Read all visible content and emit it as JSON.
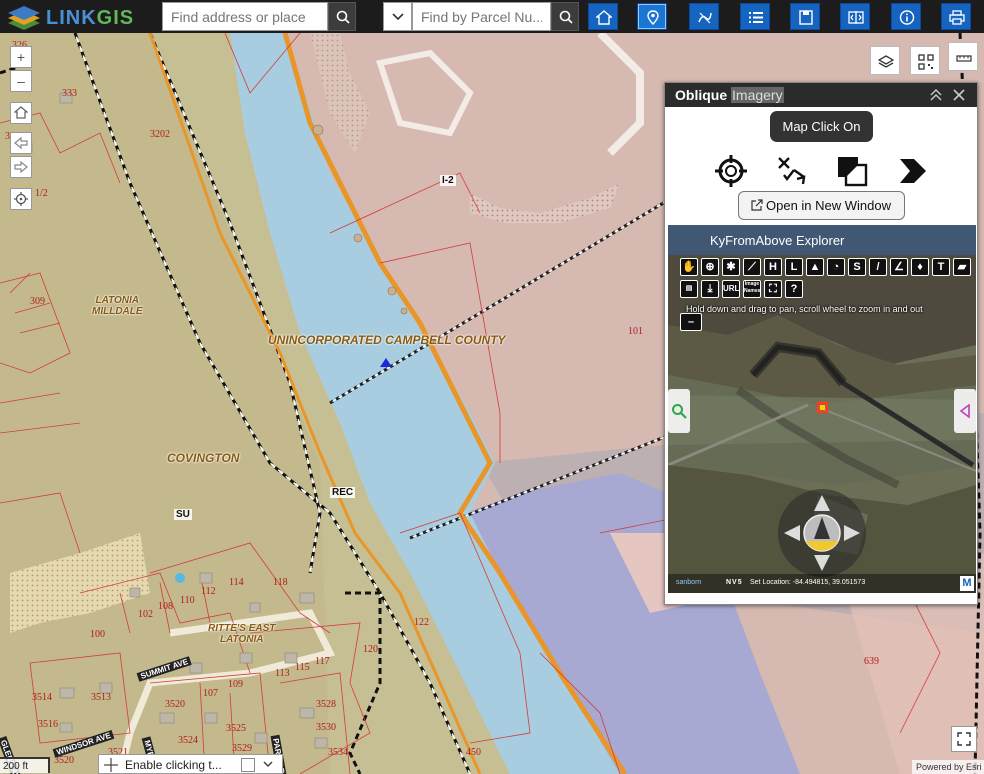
{
  "app": {
    "logo_text_a": "LINK",
    "logo_text_b": "GIS"
  },
  "search": {
    "address_placeholder": "Find address or place",
    "parcel_placeholder": "Find by Parcel Nu..."
  },
  "map": {
    "area_labels": {
      "latonia_milldale": [
        "LATONIA",
        "MILLDALE"
      ],
      "county": "UNINCORPORATED CAMPBELL COUNTY",
      "covington": "COVINGTON",
      "rittes": [
        "RITTE'S EAST",
        "LATONIA"
      ]
    },
    "zones": {
      "i2": "I-2",
      "rec": "REC",
      "su": "SU"
    },
    "streets": {
      "summit": "SUMMIT AVE",
      "glenn": "GLENN AVE",
      "windsor": "WINDSOR AVE",
      "myrtle": "MYRTLE AVE",
      "park": "PARK DR"
    },
    "parcels": {
      "p326": "326",
      "p333": "333",
      "p3202": "3202",
      "p12": "1/2",
      "p309": "309",
      "p3": "3",
      "p101": "101",
      "p102": "102",
      "p108": "108",
      "p110": "110",
      "p112": "112",
      "p114": "114",
      "p118": "118",
      "p100": "100",
      "p120": "120",
      "p122": "122",
      "p113": "113",
      "p115": "115",
      "p117": "117",
      "p107": "107",
      "p109": "109",
      "p3514": "3514",
      "p3513": "3513",
      "p3516": "3516",
      "p3520": "3520",
      "p3524": "3524",
      "p3525": "3525",
      "p3528": "3528",
      "p3529": "3529",
      "p3530": "3530",
      "p3534": "3534",
      "p3521": "3521",
      "p450": "450",
      "p639": "639",
      "p3520b": "3520"
    }
  },
  "controls": {
    "zoom_in": "+",
    "zoom_out": "–"
  },
  "widget": {
    "title": "Oblique",
    "title_highlight": "Imagery",
    "map_click": "Map Click On",
    "open_new_window": "Open in New Window",
    "explorer": {
      "title": "KyFromAbove Explorer",
      "toolbar_row1": [
        "",
        "",
        "",
        "",
        "H",
        "L",
        "",
        "",
        "S",
        "",
        "",
        "",
        "T",
        ""
      ],
      "toolbar_row2": [
        "",
        "",
        "URL",
        "Image Names",
        "",
        "?"
      ],
      "zoom_minus": "–",
      "hint": "Hold down and drag to pan, scroll wheel to zoom in and out",
      "footer_brand": "sanborn",
      "footer_nv": "NV5",
      "footer_location": "Set Location: -84.494815, 39.051573",
      "footer_m": "M"
    }
  },
  "bottom": {
    "scale": "200 ft",
    "coord_text": "Enable clicking t...",
    "attribution": "Powered by Esri"
  },
  "colors": {
    "topbar": "#1c1c1c",
    "tool_blue": "#1565c0",
    "river": "#a8cde0",
    "boundary_orange": "#e8962a"
  }
}
